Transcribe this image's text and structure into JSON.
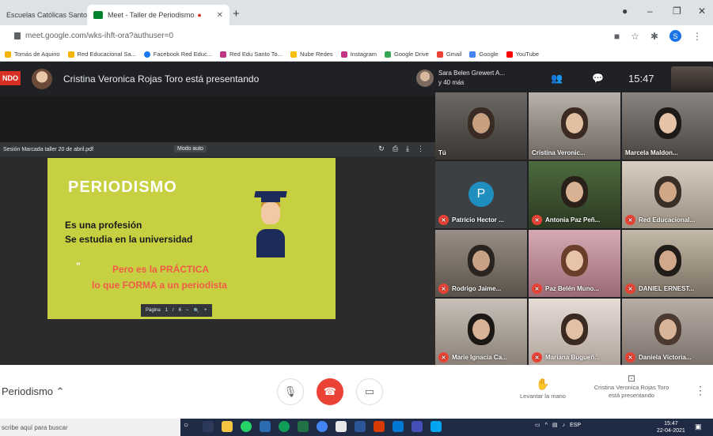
{
  "browser": {
    "tabs": [
      {
        "label": "Escuelas Católicas Santo"
      },
      {
        "label": "Meet - Taller de Periodismo"
      }
    ],
    "new_tab": "+",
    "url": "meet.google.com/wks-ihft-ora?authuser=0",
    "bookmarks": [
      {
        "label": "Tomás de Aquino",
        "color": "#f4b400"
      },
      {
        "label": "Red Educacional Sa...",
        "color": "#f4b400"
      },
      {
        "label": "Facebook Red Educ...",
        "color": "#1877f2"
      },
      {
        "label": "Red Edu Santo To...",
        "color": "#c13584"
      },
      {
        "label": "Nube Redes",
        "color": "#fbbc05"
      },
      {
        "label": "Instagram",
        "color": "#c13584"
      },
      {
        "label": "Google Drive",
        "color": "#34a853"
      },
      {
        "label": "Gmail",
        "color": "#ea4335"
      },
      {
        "label": "Google",
        "color": "#4285f4"
      },
      {
        "label": "YouTube",
        "color": "#ff0000"
      }
    ],
    "profile_initial": "S"
  },
  "meet": {
    "badge": "NDO",
    "presenting_text": "Cristina Veronica Rojas Toro está presentando",
    "pinned_name_line1": "Sara Belen Grewert A...",
    "pinned_name_line2": "y 40 más",
    "clock": "15:47",
    "pdf": {
      "title": "Sesión Marcada taller 20 de abril.pdf",
      "zoom": "Modo auto"
    },
    "slide": {
      "title": "PERIODISMO",
      "line1": "Es una profesión",
      "line2": "Se estudia en la universidad",
      "quote": "\"",
      "red1": "Pero es la PRÁCTICA",
      "red2": "lo que FORMA a un periodista",
      "page_label": "Página"
    },
    "participants": [
      {
        "name": "Tú",
        "muted": false
      },
      {
        "name": "Cristina Veronic...",
        "muted": false
      },
      {
        "name": "Marcela Maldon...",
        "muted": false
      },
      {
        "name": "Patricio Hector ...",
        "muted": true,
        "initial": "P"
      },
      {
        "name": "Antonia Paz Peñ...",
        "muted": true
      },
      {
        "name": "Red Educacional...",
        "muted": true
      },
      {
        "name": "Rodrigo Jaime...",
        "muted": true
      },
      {
        "name": "Paz Belén Muno...",
        "muted": true
      },
      {
        "name": "DANIEL ERNEST...",
        "muted": true
      },
      {
        "name": "Marie Ignacia Ca...",
        "muted": true
      },
      {
        "name": "Mariana Bugueñ...",
        "muted": true
      },
      {
        "name": "Daniela Victoria...",
        "muted": true
      }
    ],
    "bottom": {
      "meeting_name": "Periodismo",
      "raise_hand": "Levantar la mano",
      "now_presenting_line1": "Cristina Veronica Rojas Toro",
      "now_presenting_line2": "está presentando"
    }
  },
  "taskbar": {
    "search_placeholder": "scribe aquí para buscar",
    "tray_lang": "ESP",
    "time": "15:47",
    "date": "22-04-2021"
  }
}
